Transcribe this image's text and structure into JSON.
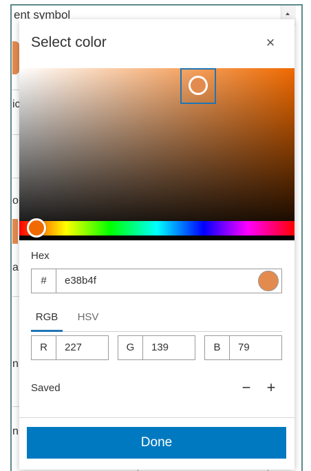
{
  "background": {
    "title_fragment": "ent symbol",
    "fragments": [
      "ic",
      "ol",
      "a",
      "n",
      "n"
    ]
  },
  "popover": {
    "title": "Select color",
    "close_icon": "close-icon"
  },
  "color_field": {
    "hue_color": "#f06a00",
    "selected_color": "#e38b4f",
    "focus_color": "#1f75b6"
  },
  "hex": {
    "label": "Hex",
    "prefix": "#",
    "value": "e38b4f"
  },
  "tabs": [
    {
      "label": "RGB",
      "active": true
    },
    {
      "label": "HSV",
      "active": false
    }
  ],
  "channels": [
    {
      "label": "R",
      "value": "227"
    },
    {
      "label": "G",
      "value": "139"
    },
    {
      "label": "B",
      "value": "79"
    }
  ],
  "saved": {
    "label": "Saved",
    "remove_label": "−",
    "add_label": "+"
  },
  "done": {
    "label": "Done",
    "color": "#0079c1"
  }
}
